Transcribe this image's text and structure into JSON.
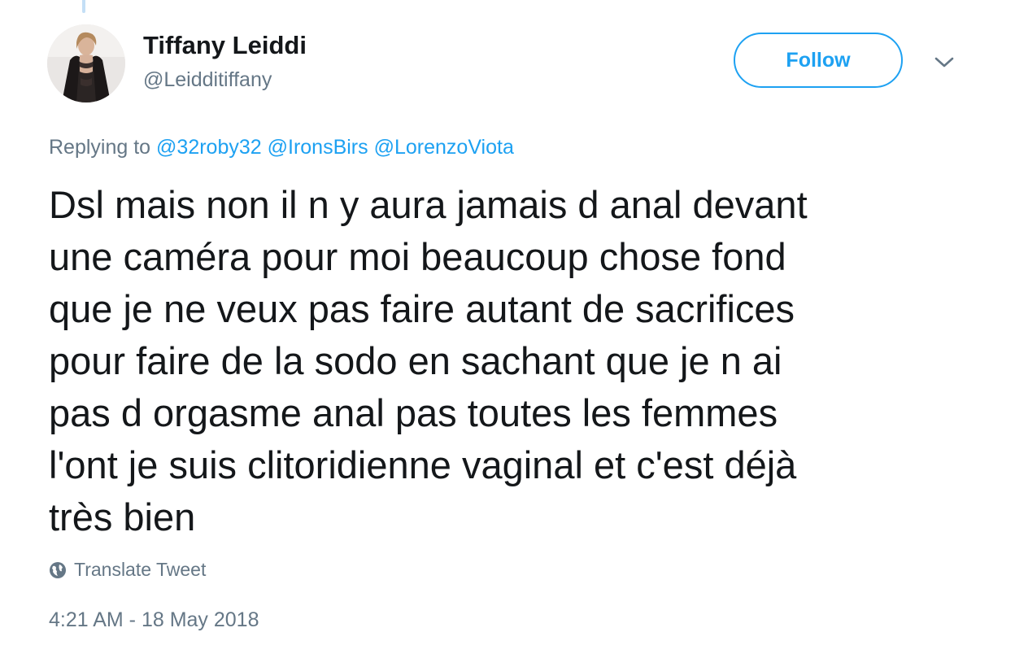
{
  "tweet": {
    "author": {
      "display_name": "Tiffany Leiddi",
      "handle": "@Leidditiffany",
      "avatar_icon": "profile-photo"
    },
    "follow_label": "Follow",
    "caret_icon": "chevron-down-icon",
    "replying": {
      "prefix": "Replying to",
      "mentions": [
        "@32roby32",
        "@IronsBirs",
        "@LorenzoViota"
      ]
    },
    "text_lines": [
      "Dsl mais non il n y aura jamais d anal devant",
      "une caméra pour moi beaucoup chose fond",
      "que je ne veux pas faire autant de sacrifices",
      "pour faire de la sodo en sachant que je n ai",
      "pas d orgasme anal pas toutes les femmes",
      "l'ont je suis clitoridienne vaginal et c'est déjà",
      "très bien"
    ],
    "translate_label": "Translate Tweet",
    "translate_icon": "globe-icon",
    "timestamp": "4:21 AM - 18 May 2018"
  },
  "colors": {
    "accent": "#1da1f2",
    "text": "#14171a",
    "secondary": "#657786",
    "thread_line": "#c4dff6"
  }
}
